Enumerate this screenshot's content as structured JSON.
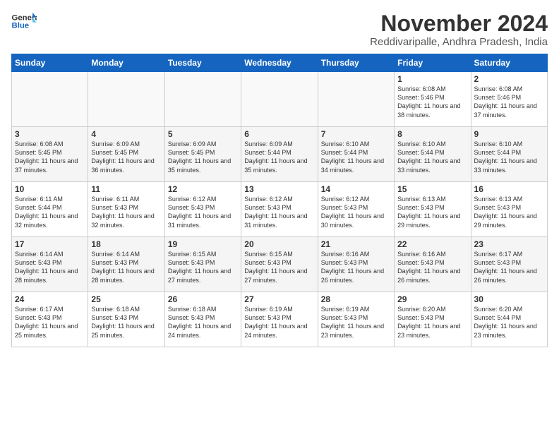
{
  "header": {
    "logo_general": "General",
    "logo_blue": "Blue",
    "month_title": "November 2024",
    "location": "Reddivaripalle, Andhra Pradesh, India"
  },
  "weekdays": [
    "Sunday",
    "Monday",
    "Tuesday",
    "Wednesday",
    "Thursday",
    "Friday",
    "Saturday"
  ],
  "rows": [
    [
      {
        "day": "",
        "info": ""
      },
      {
        "day": "",
        "info": ""
      },
      {
        "day": "",
        "info": ""
      },
      {
        "day": "",
        "info": ""
      },
      {
        "day": "",
        "info": ""
      },
      {
        "day": "1",
        "info": "Sunrise: 6:08 AM\nSunset: 5:46 PM\nDaylight: 11 hours\nand 38 minutes."
      },
      {
        "day": "2",
        "info": "Sunrise: 6:08 AM\nSunset: 5:46 PM\nDaylight: 11 hours\nand 37 minutes."
      }
    ],
    [
      {
        "day": "3",
        "info": "Sunrise: 6:08 AM\nSunset: 5:45 PM\nDaylight: 11 hours\nand 37 minutes."
      },
      {
        "day": "4",
        "info": "Sunrise: 6:09 AM\nSunset: 5:45 PM\nDaylight: 11 hours\nand 36 minutes."
      },
      {
        "day": "5",
        "info": "Sunrise: 6:09 AM\nSunset: 5:45 PM\nDaylight: 11 hours\nand 35 minutes."
      },
      {
        "day": "6",
        "info": "Sunrise: 6:09 AM\nSunset: 5:44 PM\nDaylight: 11 hours\nand 35 minutes."
      },
      {
        "day": "7",
        "info": "Sunrise: 6:10 AM\nSunset: 5:44 PM\nDaylight: 11 hours\nand 34 minutes."
      },
      {
        "day": "8",
        "info": "Sunrise: 6:10 AM\nSunset: 5:44 PM\nDaylight: 11 hours\nand 33 minutes."
      },
      {
        "day": "9",
        "info": "Sunrise: 6:10 AM\nSunset: 5:44 PM\nDaylight: 11 hours\nand 33 minutes."
      }
    ],
    [
      {
        "day": "10",
        "info": "Sunrise: 6:11 AM\nSunset: 5:44 PM\nDaylight: 11 hours\nand 32 minutes."
      },
      {
        "day": "11",
        "info": "Sunrise: 6:11 AM\nSunset: 5:43 PM\nDaylight: 11 hours\nand 32 minutes."
      },
      {
        "day": "12",
        "info": "Sunrise: 6:12 AM\nSunset: 5:43 PM\nDaylight: 11 hours\nand 31 minutes."
      },
      {
        "day": "13",
        "info": "Sunrise: 6:12 AM\nSunset: 5:43 PM\nDaylight: 11 hours\nand 31 minutes."
      },
      {
        "day": "14",
        "info": "Sunrise: 6:12 AM\nSunset: 5:43 PM\nDaylight: 11 hours\nand 30 minutes."
      },
      {
        "day": "15",
        "info": "Sunrise: 6:13 AM\nSunset: 5:43 PM\nDaylight: 11 hours\nand 29 minutes."
      },
      {
        "day": "16",
        "info": "Sunrise: 6:13 AM\nSunset: 5:43 PM\nDaylight: 11 hours\nand 29 minutes."
      }
    ],
    [
      {
        "day": "17",
        "info": "Sunrise: 6:14 AM\nSunset: 5:43 PM\nDaylight: 11 hours\nand 28 minutes."
      },
      {
        "day": "18",
        "info": "Sunrise: 6:14 AM\nSunset: 5:43 PM\nDaylight: 11 hours\nand 28 minutes."
      },
      {
        "day": "19",
        "info": "Sunrise: 6:15 AM\nSunset: 5:43 PM\nDaylight: 11 hours\nand 27 minutes."
      },
      {
        "day": "20",
        "info": "Sunrise: 6:15 AM\nSunset: 5:43 PM\nDaylight: 11 hours\nand 27 minutes."
      },
      {
        "day": "21",
        "info": "Sunrise: 6:16 AM\nSunset: 5:43 PM\nDaylight: 11 hours\nand 26 minutes."
      },
      {
        "day": "22",
        "info": "Sunrise: 6:16 AM\nSunset: 5:43 PM\nDaylight: 11 hours\nand 26 minutes."
      },
      {
        "day": "23",
        "info": "Sunrise: 6:17 AM\nSunset: 5:43 PM\nDaylight: 11 hours\nand 26 minutes."
      }
    ],
    [
      {
        "day": "24",
        "info": "Sunrise: 6:17 AM\nSunset: 5:43 PM\nDaylight: 11 hours\nand 25 minutes."
      },
      {
        "day": "25",
        "info": "Sunrise: 6:18 AM\nSunset: 5:43 PM\nDaylight: 11 hours\nand 25 minutes."
      },
      {
        "day": "26",
        "info": "Sunrise: 6:18 AM\nSunset: 5:43 PM\nDaylight: 11 hours\nand 24 minutes."
      },
      {
        "day": "27",
        "info": "Sunrise: 6:19 AM\nSunset: 5:43 PM\nDaylight: 11 hours\nand 24 minutes."
      },
      {
        "day": "28",
        "info": "Sunrise: 6:19 AM\nSunset: 5:43 PM\nDaylight: 11 hours\nand 23 minutes."
      },
      {
        "day": "29",
        "info": "Sunrise: 6:20 AM\nSunset: 5:43 PM\nDaylight: 11 hours\nand 23 minutes."
      },
      {
        "day": "30",
        "info": "Sunrise: 6:20 AM\nSunset: 5:44 PM\nDaylight: 11 hours\nand 23 minutes."
      }
    ]
  ]
}
